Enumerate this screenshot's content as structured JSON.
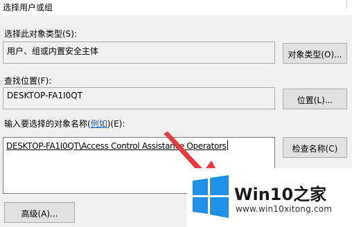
{
  "window": {
    "title": "选择用户或组"
  },
  "object_type": {
    "label": "选择此对象类型(S):",
    "value": "用户、组或内置安全主体",
    "button": "对象类型(O)..."
  },
  "location": {
    "label": "查找位置(F):",
    "value": "DESKTOP-FA1I0QT",
    "button": "位置(L)..."
  },
  "object_names": {
    "label_prefix": "输入要选择的对象名称(",
    "label_link": "例如",
    "label_suffix": ")(E):",
    "value": "DESKTOP-FA1I0QT\\Access Control Assistance Operators",
    "button": "检查名称(C)"
  },
  "advanced_button": "高级(A)...",
  "annotation": {
    "arrow_color": "#e8383d"
  },
  "watermark": {
    "brand": "Win10",
    "brand_zh": "之家",
    "url": "www.win10xitong.com",
    "logo_color": "#1e90e6"
  }
}
